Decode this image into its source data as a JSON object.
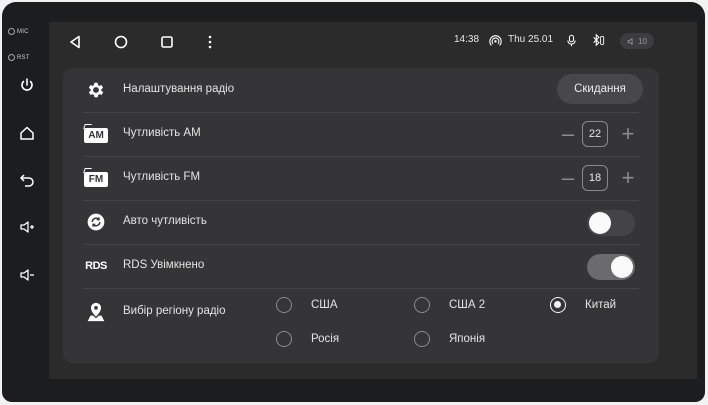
{
  "hardware": {
    "mic_label": "MIC",
    "rst_label": "RST",
    "buttons": [
      "power-icon",
      "home-icon",
      "back-icon",
      "volume-up-icon",
      "volume-down-icon"
    ]
  },
  "statusbar": {
    "time": "14:38",
    "date": "Thu 25.01",
    "volume": "10",
    "icons": [
      "back-icon",
      "home-icon",
      "recents-icon",
      "menu-icon",
      "hotspot-icon",
      "mic-icon",
      "bluetooth-icon",
      "volume-icon"
    ]
  },
  "settings": {
    "title": "Налаштування радіо",
    "reset_label": "Скидання",
    "am": {
      "label": "Чутливість АМ",
      "value": "22",
      "icon_text": "AM"
    },
    "fm": {
      "label": "Чутливість FM",
      "value": "18",
      "icon_text": "FM"
    },
    "auto": {
      "label": "Авто чутливість",
      "enabled": false
    },
    "rds": {
      "label": "RDS Увімкнено",
      "icon_text": "RDS",
      "enabled": true
    },
    "region": {
      "label": "Вибір регіону радіо",
      "options": [
        "США",
        "США 2",
        "Китай",
        "Росія",
        "Японія"
      ],
      "selected": "Китай"
    }
  },
  "colors": {
    "screen_bg": "#2b2b2c",
    "panel_bg": "#353537",
    "toggle_on": "#6b6b6d",
    "toggle_off": "#444446"
  }
}
